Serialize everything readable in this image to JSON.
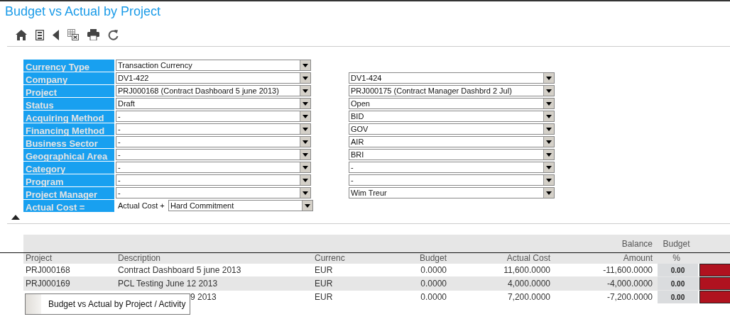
{
  "title": "Budget vs Actual by Project",
  "filters": [
    {
      "label": "Currency Type",
      "from": "Transaction Currency"
    },
    {
      "label": "Company",
      "from": "DV1-422",
      "to": "DV1-424"
    },
    {
      "label": "Project",
      "from": "PRJ000168 (Contract Dashboard 5 june 2013)",
      "to": "PRJ000175 (Contract Manager Dashbrd 2 Jul)"
    },
    {
      "label": "Status",
      "from": "Draft",
      "to": "Open"
    },
    {
      "label": "Acquiring Method",
      "from": "-",
      "to": "BID"
    },
    {
      "label": "Financing Method",
      "from": "-",
      "to": "GOV"
    },
    {
      "label": "Business Sector",
      "from": "-",
      "to": "AIR"
    },
    {
      "label": "Geographical Area",
      "from": "-",
      "to": "BRI"
    },
    {
      "label": "Category",
      "from": "-",
      "to": "-"
    },
    {
      "label": "Program",
      "from": "-",
      "to": "-"
    },
    {
      "label": "Project Manager",
      "from": "-",
      "to": "Wim Treur"
    }
  ],
  "actual_cost": {
    "label": "Actual Cost =",
    "prefix": "Actual Cost +",
    "value": "Hard Commitment"
  },
  "table": {
    "columns": [
      {
        "label": "Project"
      },
      {
        "label": "Description"
      },
      {
        "label": "Currenc"
      },
      {
        "label": "Budget"
      },
      {
        "label": "Actual Cost"
      },
      {
        "top": "Balance",
        "label": "Amount"
      },
      {
        "top": "Budget",
        "label": "%"
      }
    ],
    "rows": [
      {
        "project": "PRJ000168",
        "description": "Contract Dashboard 5 june 2013",
        "currency": "EUR",
        "budget": "0.0000",
        "actual_cost": "11,600.0000",
        "balance": "-11,600.0000",
        "budget_pct": "0.00",
        "color": "#b0121f"
      },
      {
        "project": "PRJ000169",
        "description": "PCL Testing June 12 2013",
        "currency": "EUR",
        "budget": "0.0000",
        "actual_cost": "4,000.0000",
        "balance": "-4,000.0000",
        "budget_pct": "0.00",
        "color": "#b0121f"
      },
      {
        "description": "9 2013",
        "currency": "EUR",
        "budget": "0.0000",
        "actual_cost": "7,200.0000",
        "balance": "-7,200.0000",
        "budget_pct": "0.00",
        "color": "#b0121f"
      }
    ]
  },
  "tooltip": {
    "text": "Budget vs Actual by Project / Activity"
  }
}
